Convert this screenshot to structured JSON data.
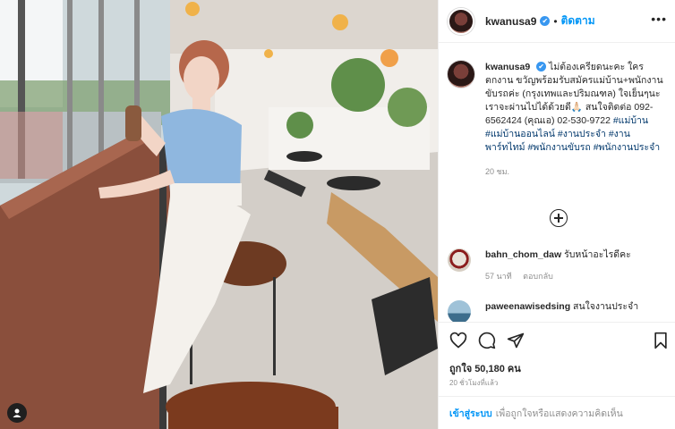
{
  "post": {
    "username": "kwanusa9",
    "verified_mark": "✔",
    "follow_label": "ติดตาม",
    "more_label": "•••",
    "caption_text": "ไม่ต้องเครียดนะคะ ใครตกงาน ขวัญพร้อมรับสมัครแม่บ้าน+พนักงานขับรถค่ะ (กรุงเทพและปริมณฑล) ใจเย็นๆนะ เราจะผ่านไปได้ด้วยดี🙏🏻 สนใจติดต่อ 092-6562424 (คุณเอ) 02-530-9722",
    "hashtags": [
      "#แม่บ้าน",
      "#แม่บ้านออนไลน์",
      "#งานประจำ",
      "#งานพาร์ทไทม์",
      "#พนักงานขับรถ",
      "#พนักงานประจำ"
    ],
    "caption_time": "20 ชม.",
    "likes": "ถูกใจ 50,180 คน",
    "post_time": "20 ชั่วโมงที่แล้ว",
    "add_comment_login": "เข้าสู่ระบบ",
    "add_comment_rest": "เพื่อถูกใจหรือแสดงความคิดเห็น"
  },
  "comments": [
    {
      "username": "bahn_chom_daw",
      "text": "รับหน้าอะไรดีคะ",
      "time": "57 นาที",
      "reply_label": "ตอบกลับ"
    },
    {
      "username": "paweenawisedsing",
      "text": "สนใจงานประจำ"
    }
  ],
  "icons": {
    "like": "heart-icon",
    "comment": "comment-icon",
    "share": "share-icon",
    "save": "bookmark-icon",
    "load_more": "plus-circle-icon",
    "tag": "user-tag-icon"
  },
  "colors": {
    "link": "#0095f6",
    "hashtag": "#00376b",
    "secondary_text": "#8e8e8e",
    "verified": "#3897f0"
  }
}
